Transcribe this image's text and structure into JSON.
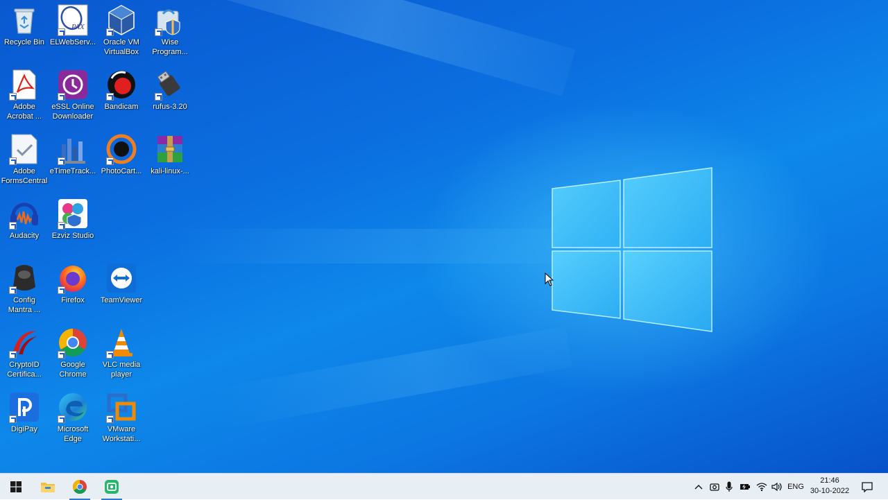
{
  "desktop": {
    "icons": [
      {
        "label": "Recycle Bin",
        "icon": "recycle-bin-icon"
      },
      {
        "label": "ELWebServ...",
        "icon": "elwebserv-icon"
      },
      {
        "label": "Oracle VM\nVirtualBox",
        "icon": "virtualbox-icon"
      },
      {
        "label": "Wise\nProgram...",
        "icon": "wise-program-icon"
      },
      {
        "label": "Adobe\nAcrobat ...",
        "icon": "adobe-acrobat-icon"
      },
      {
        "label": "eSSL Online\nDownloader",
        "icon": "essl-downloader-icon"
      },
      {
        "label": "Bandicam",
        "icon": "bandicam-icon"
      },
      {
        "label": "rufus-3.20",
        "icon": "rufus-icon"
      },
      {
        "label": "Adobe\nFormsCentral",
        "icon": "adobe-formscentral-icon"
      },
      {
        "label": "eTimeTrack...",
        "icon": "etimetrack-icon"
      },
      {
        "label": "PhotoCart...",
        "icon": "photocart-icon"
      },
      {
        "label": "kali-linux-...",
        "icon": "winrar-archive-icon"
      },
      {
        "label": "Audacity",
        "icon": "audacity-icon"
      },
      {
        "label": "Ezviz Studio",
        "icon": "ezviz-studio-icon"
      },
      {
        "label": "Config\nMantra ...",
        "icon": "fingerprint-scanner-icon"
      },
      {
        "label": "Firefox",
        "icon": "firefox-icon"
      },
      {
        "label": "TeamViewer",
        "icon": "teamviewer-icon"
      },
      {
        "label": "CryptoID\nCertifica...",
        "icon": "cryptoid-icon"
      },
      {
        "label": "Google\nChrome",
        "icon": "chrome-icon"
      },
      {
        "label": "VLC media\nplayer",
        "icon": "vlc-icon"
      },
      {
        "label": "DigiPay",
        "icon": "digipay-icon"
      },
      {
        "label": "Microsoft\nEdge",
        "icon": "edge-icon"
      },
      {
        "label": "VMware\nWorkstati...",
        "icon": "vmware-icon"
      }
    ]
  },
  "taskbar": {
    "pinned": [
      {
        "icon": "windows-start-icon"
      },
      {
        "icon": "file-explorer-icon"
      },
      {
        "icon": "chrome-icon"
      },
      {
        "icon": "screen-recorder-icon"
      }
    ],
    "tray": {
      "language": "ENG",
      "time": "21:46",
      "date": "30-10-2022"
    }
  },
  "colors": {
    "desktop_blue": "#0b6fe0",
    "taskbar_bg": "#e7eef4",
    "accent": "#2b78d6"
  }
}
